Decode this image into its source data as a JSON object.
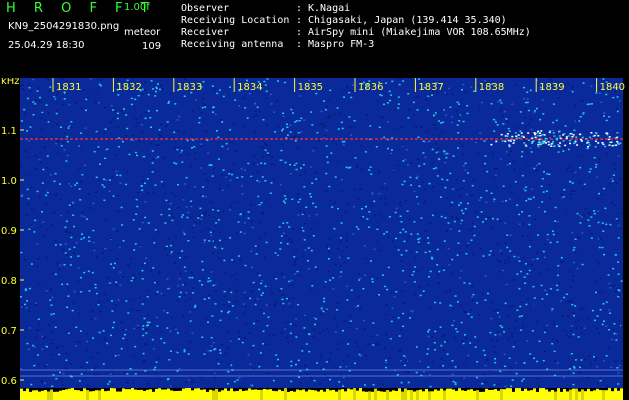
{
  "header": {
    "app_title": "H R O F F T",
    "version": "1.00f",
    "file_name": "KN9_2504291830.png",
    "timestamp": "25.04.29 18:30",
    "meteo_label": "meteor",
    "meteo_count": "109",
    "info": [
      {
        "label": "Observer",
        "value": "K.Nagai"
      },
      {
        "label": "Receiving Location",
        "value": "Chigasaki, Japan (139.414 35.340)"
      },
      {
        "label": "Receiver",
        "value": "AirSpy mini (Miakejima VOR 108.65MHz)"
      },
      {
        "label": "Receiving antenna",
        "value": "Maspro FM-3"
      }
    ]
  },
  "spectrogram": {
    "unit_label": "kHz",
    "y_ticks": [
      "1.1",
      "1.0",
      "0.9",
      "0.8",
      "0.7",
      "0.6"
    ],
    "time_ticks": [
      "1831",
      "1832",
      "1833",
      "1834",
      "1835",
      "1836",
      "1837",
      "1838",
      "1839",
      "1840"
    ],
    "colors": {
      "background": "#0a2a9c",
      "noise_dark": "#071a70",
      "noise_cyan": "#22c8e8",
      "signal": "#ffffff",
      "trace": "#ff3030",
      "axis_text": "#ffff33",
      "bottom_bar": "#ffff00"
    }
  }
}
